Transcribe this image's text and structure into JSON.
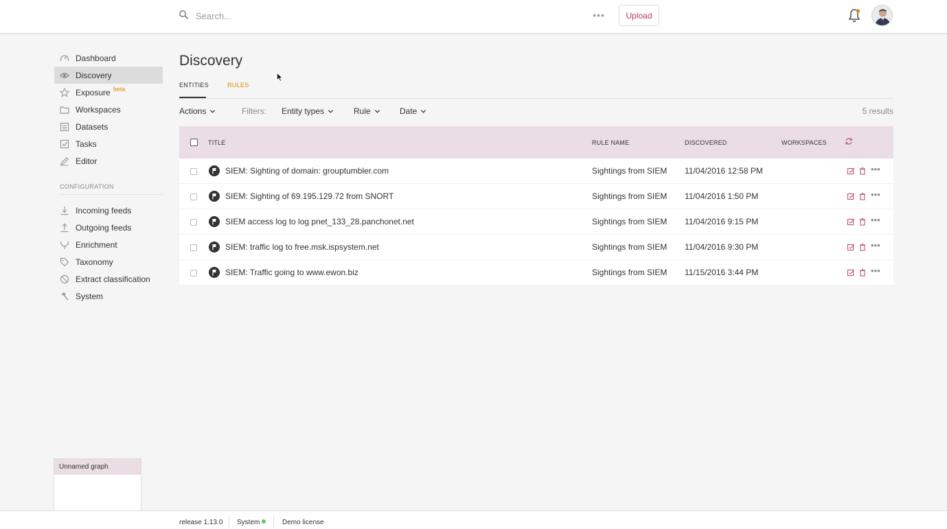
{
  "header": {
    "search_placeholder": "Search...",
    "more_label": "•••",
    "upload_label": "Upload"
  },
  "sidebar": {
    "items": [
      {
        "label": "Dashboard",
        "icon": "dashboard-icon"
      },
      {
        "label": "Discovery",
        "icon": "eye-icon",
        "active": true
      },
      {
        "label": "Exposure",
        "icon": "star-icon",
        "badge": "beta"
      },
      {
        "label": "Workspaces",
        "icon": "folder-icon"
      },
      {
        "label": "Datasets",
        "icon": "list-icon"
      },
      {
        "label": "Tasks",
        "icon": "checkbox-icon"
      },
      {
        "label": "Editor",
        "icon": "pencil-icon"
      }
    ],
    "config_label": "CONFIGURATION",
    "config_items": [
      {
        "label": "Incoming feeds",
        "icon": "download-icon"
      },
      {
        "label": "Outgoing feeds",
        "icon": "upload-icon"
      },
      {
        "label": "Enrichment",
        "icon": "merge-icon"
      },
      {
        "label": "Taxonomy",
        "icon": "tag-icon"
      },
      {
        "label": "Extract classification",
        "icon": "block-icon"
      },
      {
        "label": "System",
        "icon": "hammer-icon"
      }
    ]
  },
  "main": {
    "title": "Discovery",
    "tabs": [
      {
        "label": "ENTITIES",
        "active": true
      },
      {
        "label": "RULES"
      }
    ],
    "toolbar": {
      "actions": "Actions",
      "filters": "Filters:",
      "entity_types": "Entity types",
      "rule": "Rule",
      "date": "Date",
      "results": "5 results"
    },
    "table": {
      "headers": {
        "title": "TITLE",
        "rule_name": "RULE NAME",
        "discovered": "DISCOVERED",
        "workspaces": "WORKSPACES"
      },
      "rows": [
        {
          "title": "SIEM: Sighting of domain: grouptumbler.com",
          "rule": "Sightings from SIEM",
          "discovered": "11/04/2016 12:58 PM"
        },
        {
          "title": "SIEM: Sighting of 69.195.129.72 from SNORT",
          "rule": "Sightings from SIEM",
          "discovered": "11/04/2016 1:50 PM"
        },
        {
          "title": "SIEM access log to log pnet_133_28.panchonet.net",
          "rule": "Sightings from SIEM",
          "discovered": "11/04/2016 9:15 PM"
        },
        {
          "title": "SIEM: traffic log to free.msk.ispsystem.net",
          "rule": "Sightings from SIEM",
          "discovered": "11/04/2016 9:30 PM"
        },
        {
          "title": "SIEM: Traffic going to www.ewon.biz",
          "rule": "Sightings from SIEM",
          "discovered": "11/15/2016 3:44 PM"
        }
      ]
    }
  },
  "graph_panel": {
    "title": "Unnamed graph"
  },
  "footer": {
    "release": "release 1.13.0",
    "system": "System",
    "license": "Demo license"
  },
  "colors": {
    "accent": "#b03a6a",
    "rules_tab": "#e08a00",
    "table_header": "#eadde3",
    "status_ok": "#6abf69"
  }
}
